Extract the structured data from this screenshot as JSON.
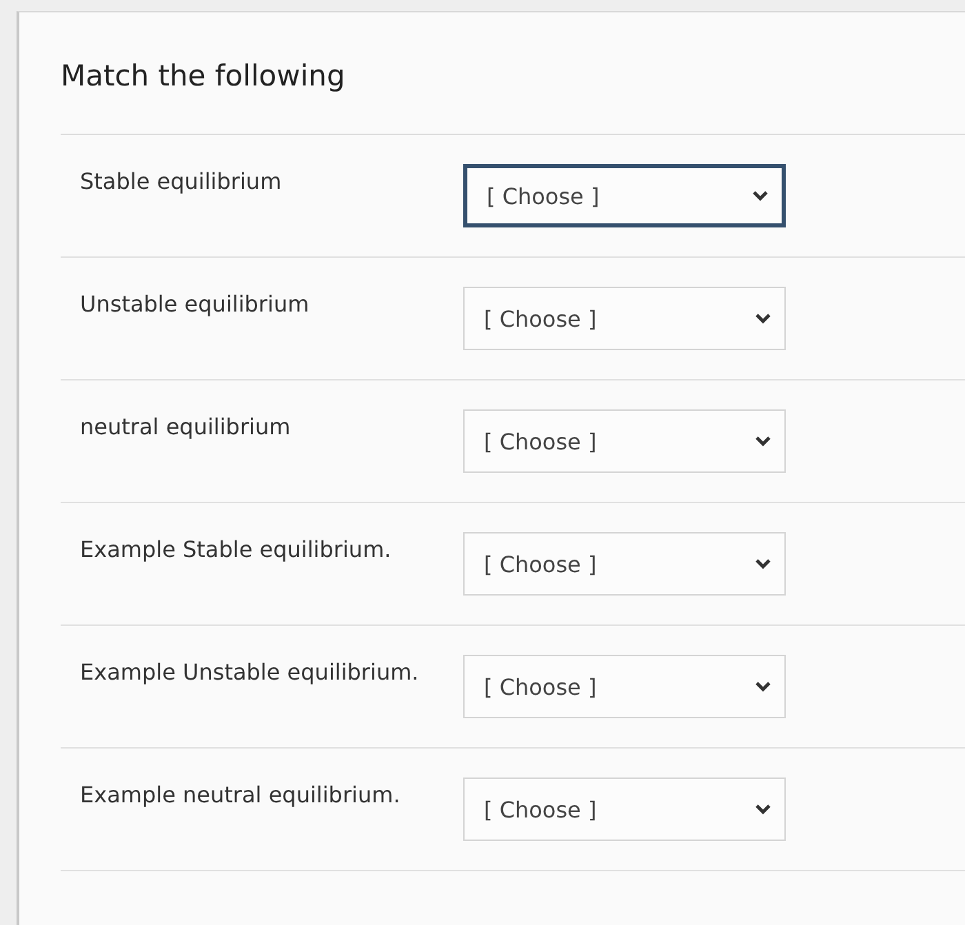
{
  "question": {
    "title": "Match the following",
    "rows": [
      {
        "label": "Stable equilibrium",
        "dropdown": {
          "value": "[ Choose ]",
          "focused": true
        }
      },
      {
        "label": "Unstable equilibrium",
        "dropdown": {
          "value": "[ Choose ]",
          "focused": false
        }
      },
      {
        "label": "neutral equilibrium",
        "dropdown": {
          "value": "[ Choose ]",
          "focused": false
        }
      },
      {
        "label": "Example Stable equilibrium.",
        "dropdown": {
          "value": "[ Choose ]",
          "focused": false
        }
      },
      {
        "label": "Example Unstable equilibrium.",
        "dropdown": {
          "value": "[ Choose ]",
          "focused": false
        }
      },
      {
        "label": "Example neutral equilibrium.",
        "dropdown": {
          "value": "[ Choose ]",
          "focused": false
        }
      }
    ]
  }
}
